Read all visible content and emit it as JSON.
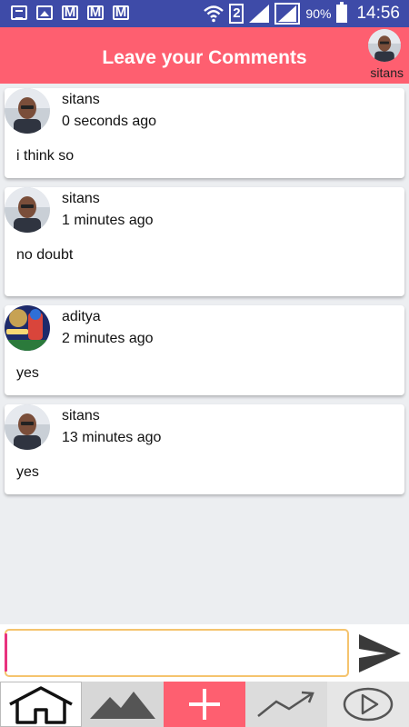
{
  "status_bar": {
    "sim_number": "2",
    "battery": "90%",
    "time": "14:56"
  },
  "header": {
    "title": "Leave your Comments",
    "username": "sitans"
  },
  "comments": [
    {
      "user": "sitans",
      "time": "0 seconds ago",
      "text": "i think so"
    },
    {
      "user": "sitans",
      "time": "1 minutes ago",
      "text": "no doubt"
    },
    {
      "user": "aditya",
      "time": "2 minutes ago",
      "text": "yes"
    },
    {
      "user": "sitans",
      "time": "13 minutes ago",
      "text": "yes"
    }
  ],
  "input": {
    "value": "",
    "placeholder": ""
  },
  "nav": {
    "items": [
      {
        "icon": "home-icon"
      },
      {
        "icon": "mountain-icon"
      },
      {
        "icon": "plus-icon"
      },
      {
        "icon": "trend-icon"
      },
      {
        "icon": "play-icon"
      }
    ]
  },
  "colors": {
    "status_bar": "#3e4ba8",
    "header": "#fe5f70",
    "accent_add": "#fe5f70",
    "input_border": "#f5c46e"
  }
}
